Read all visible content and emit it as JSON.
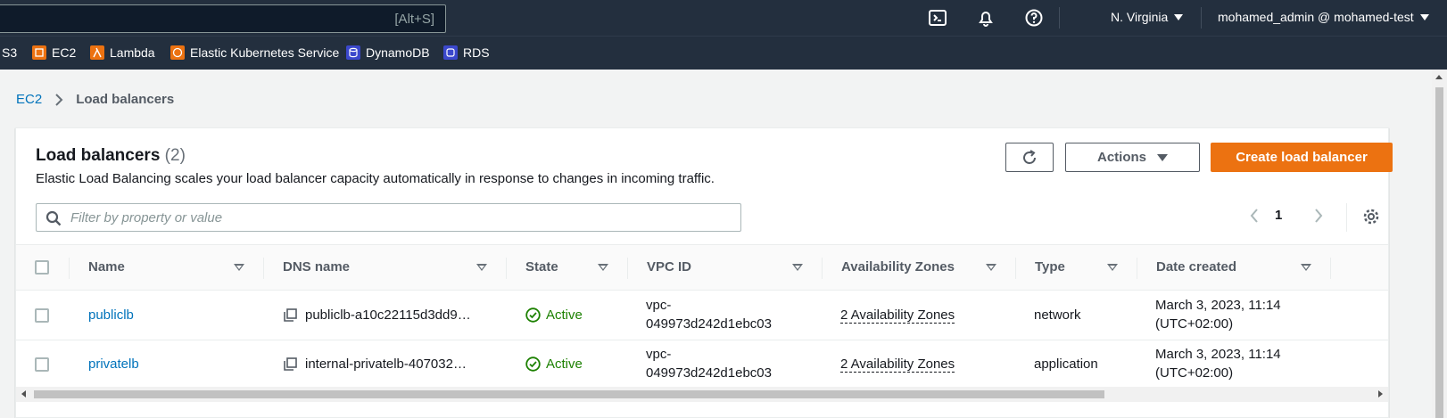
{
  "topnav": {
    "search_shortcut": "[Alt+S]",
    "region": "N. Virginia",
    "user": "mohamed_admin @ mohamed-test",
    "icons": [
      "cloudshell-icon",
      "bell-icon",
      "help-icon"
    ]
  },
  "favorites": [
    {
      "label": "S3",
      "icon": "",
      "color": ""
    },
    {
      "label": "EC2",
      "icon": "ec2-icon",
      "color": "#ec7211"
    },
    {
      "label": "Lambda",
      "icon": "lambda-icon",
      "color": "#ec7211"
    },
    {
      "label": "Elastic Kubernetes Service",
      "icon": "eks-icon",
      "color": "#ec7211"
    },
    {
      "label": "DynamoDB",
      "icon": "dynamodb-icon",
      "color": "#3b48cc"
    },
    {
      "label": "RDS",
      "icon": "rds-icon",
      "color": "#3b48cc"
    }
  ],
  "breadcrumb": {
    "parent": "EC2",
    "current": "Load balancers"
  },
  "panel": {
    "title": "Load balancers",
    "count": "(2)",
    "description": "Elastic Load Balancing scales your load balancer capacity automatically in response to changes in incoming traffic.",
    "actions_label": "Actions",
    "create_label": "Create load balancer",
    "filter_placeholder": "Filter by property or value",
    "page": "1"
  },
  "table": {
    "columns": [
      "Name",
      "DNS name",
      "State",
      "VPC ID",
      "Availability Zones",
      "Type",
      "Date created"
    ],
    "rows": [
      {
        "name": "publiclb",
        "dns": "publiclb-a10c22115d3dd9…",
        "state": "Active",
        "vpc_line1": "vpc-",
        "vpc_line2": "049973d242d1ebc03",
        "az": "2 Availability Zones",
        "type": "network",
        "date_line1": "March 3, 2023, 11:14",
        "date_line2": "(UTC+02:00)"
      },
      {
        "name": "privatelb",
        "dns": "internal-privatelb-407032…",
        "state": "Active",
        "vpc_line1": "vpc-",
        "vpc_line2": "049973d242d1ebc03",
        "az": "2 Availability Zones",
        "type": "application",
        "date_line1": "March 3, 2023, 11:14",
        "date_line2": "(UTC+02:00)"
      }
    ]
  },
  "colors": {
    "accent": "#ec7211",
    "link": "#0073bb",
    "success": "#1d8102",
    "nav_bg": "#232f3e"
  }
}
